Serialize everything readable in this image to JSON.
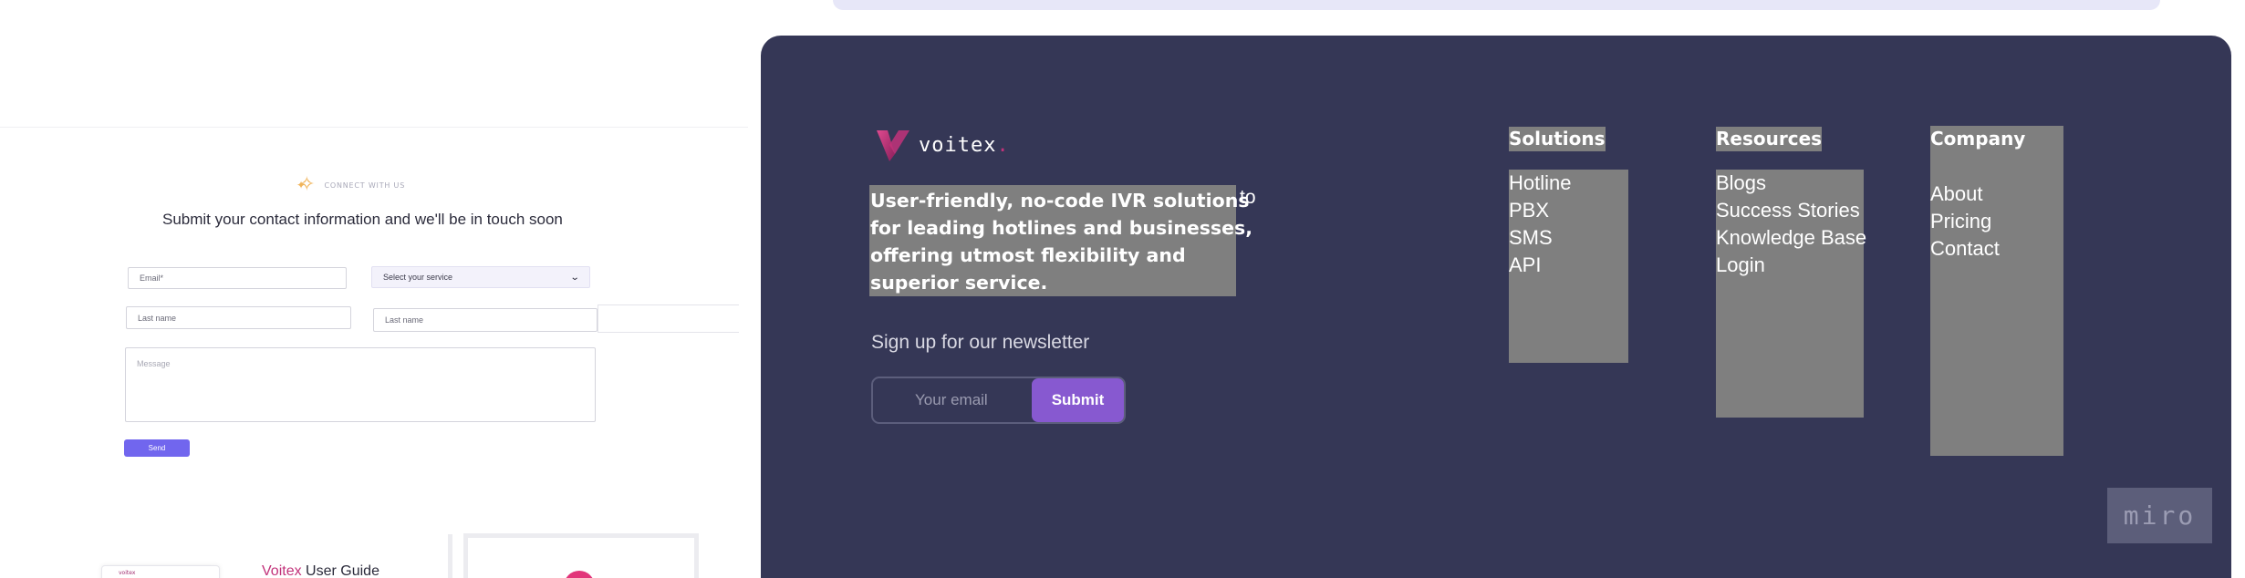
{
  "contact_section": {
    "eyebrow": "CONNECT WITH US",
    "heading": "Submit your contact information and we'll be in touch soon",
    "email_placeholder": "Email*",
    "service_select_value": "Select your service",
    "last_name_placeholder_1": "Last name",
    "last_name_placeholder_2": "Last name",
    "message_placeholder": "Message",
    "send_label": "Send"
  },
  "guide_card": {
    "thumb_logo": "voitex",
    "brand": "Voitex",
    "title_rest": " User Guide"
  },
  "footer": {
    "logo_text": "voitex",
    "logo_dot": ".",
    "tagline_tail": "to",
    "tagline_lines": [
      "User-friendly, no-code IVR solutions",
      "for leading hotlines and businesses,",
      "offering utmost flexibility and",
      "superior service."
    ],
    "newsletter_label": "Sign up for our newsletter",
    "email_placeholder": "Your email",
    "submit_label": "Submit",
    "columns": [
      {
        "heading": "Solutions",
        "items": [
          "Hotline",
          "PBX",
          "SMS",
          "API"
        ]
      },
      {
        "heading": "Resources",
        "items": [
          "Blogs",
          "Success Stories",
          "Knowledge Base",
          "Login"
        ]
      },
      {
        "heading": "Company",
        "items": [
          "About",
          "Pricing",
          "Contact"
        ]
      }
    ],
    "watermark": "miro"
  },
  "colors": {
    "footer_bg": "#353756",
    "submit_bg": "#8759d0",
    "send_bg": "#7166ee",
    "brand_magenta": "#c2327a",
    "highlight_gray": "#7f7f7f"
  },
  "icons": [
    "sparkle-icon",
    "chevron-down-icon",
    "voitex-logo-icon"
  ]
}
